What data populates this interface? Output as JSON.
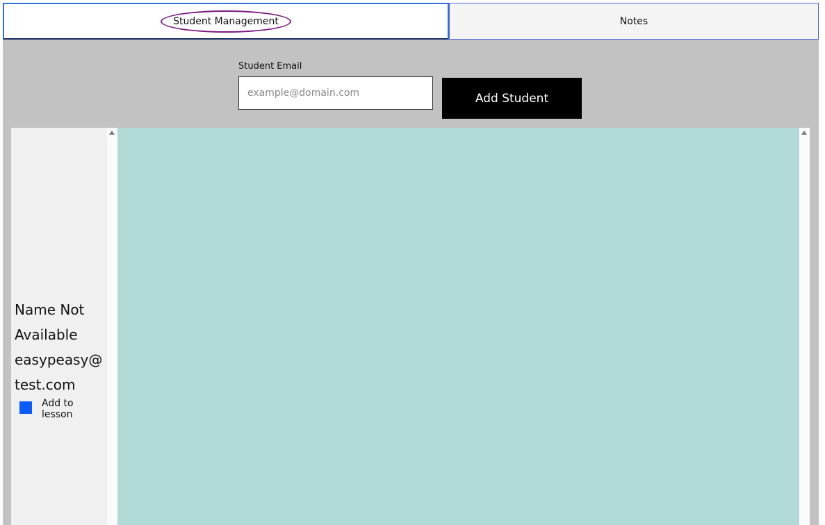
{
  "tabs": [
    {
      "label": "Student Management",
      "active": true
    },
    {
      "label": "Notes",
      "active": false
    }
  ],
  "form": {
    "email_label": "Student Email",
    "email_placeholder": "example@domain.com",
    "email_value": "",
    "add_button_label": "Add Student"
  },
  "students": [
    {
      "name": "Name Not Available",
      "email": "easypeasy@test.com",
      "checkbox_label": "Add to lesson",
      "checked": true
    }
  ],
  "colors": {
    "panel_bg": "#c2c2c2",
    "content_bg": "#b1d9d5",
    "card_bg": "#f0f0f0",
    "button_bg": "#000000",
    "checkbox": "#0a5cff",
    "active_tab_oval": "#7a1a7e",
    "tab_border": "#2f6fe0"
  },
  "icons": {
    "scroll_up": "scroll-up-arrow-icon"
  }
}
